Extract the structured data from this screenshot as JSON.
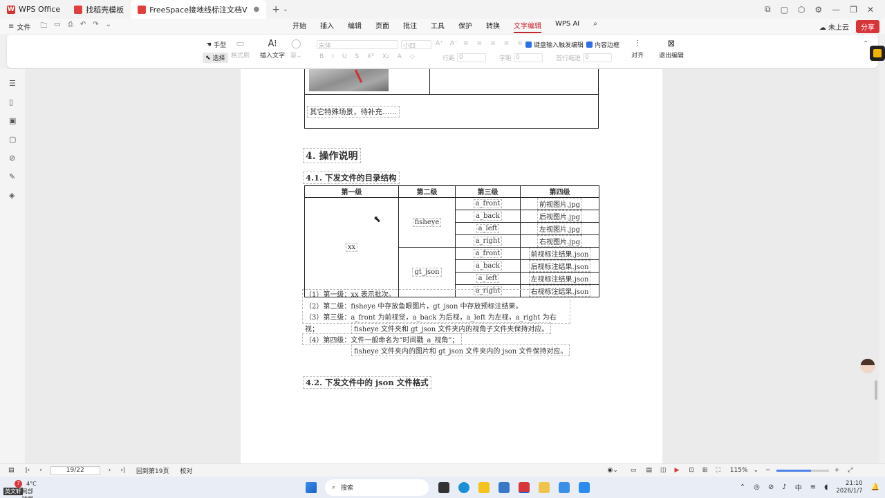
{
  "titlebar": {
    "tabs": [
      {
        "label": "WPS Office"
      },
      {
        "label": "找稻壳模板"
      },
      {
        "label": "FreeSpace接地线标注文档V"
      }
    ]
  },
  "menubar": {
    "file": "文件",
    "tabs": [
      "开始",
      "插入",
      "编辑",
      "页面",
      "批注",
      "工具",
      "保护",
      "转换",
      "文字编辑",
      "WPS AI"
    ],
    "selected_tab": "文字编辑",
    "cloud": "未上云",
    "share": "分享"
  },
  "ribbon": {
    "hand": "手型",
    "select": "选择",
    "format_painter": "格式刷",
    "insert_text": "插入文字",
    "font": "宋体",
    "font_size": "小四",
    "line_spacing_label": "行距",
    "line_spacing_value": "0",
    "char_spacing_label": "字距",
    "char_spacing_value": "0",
    "indent_label": "首行缩进",
    "indent_value": "0",
    "keyboard_input": "键盘输入触发编辑",
    "content_border": "内容边框",
    "align": "对齐",
    "exit_edit": "退出编辑"
  },
  "document": {
    "prev_cell_text": "其它特殊场景，待补充……",
    "heading4": "4.  操作说明",
    "heading41": "4.1.  下发文件的目录结构",
    "table": {
      "headers": [
        "第一级",
        "第二级",
        "第三级",
        "第四级"
      ],
      "level1": "xx",
      "groups": [
        {
          "level2": "fisheye",
          "rows": [
            [
              "a_front",
              "前视图片.jpg"
            ],
            [
              "a_back",
              "后视图片.jpg"
            ],
            [
              "a_left",
              "左视图片.jpg"
            ],
            [
              "a_right",
              "右视图片.jpg"
            ]
          ]
        },
        {
          "level2": "gt_json",
          "rows": [
            [
              "a_front",
              "前视标注结果.json"
            ],
            [
              "a_back",
              "后视标注结果.json"
            ],
            [
              "a_left",
              "左视标注结果.json"
            ],
            [
              "a_right",
              "右视标注结果.json"
            ]
          ]
        }
      ]
    },
    "notes": [
      "（1）第一级：xx 表示批次。",
      "（2）第二级：fisheye 中存放鱼眼图片，gt_json 中存放预标注结果。",
      "（3）第三级：a_front 为前视觉，a_back 为后视，a_left 为左视，a_right 为右视；",
      "fisheye 文件夹和 gt_json 文件夹内的视角子文件夹保持对应。",
      "（4）第四级：文件一般命名为“时间戳_a_视角”；",
      "fisheye 文件夹内的图片和 gt_json 文件夹内的 json 文件保持对应。"
    ],
    "heading42": "4.2.  下发文件中的 json 文件格式"
  },
  "statusbar": {
    "page": "19/22",
    "back_page": "回到第19页",
    "proofread": "校对",
    "zoom": "115%"
  },
  "taskbar": {
    "weather_temp": "4°C",
    "weather_desc": "局部晴朗",
    "weather_badge": "7",
    "search": "搜索",
    "ime": "中",
    "time": "21:10",
    "date": "2026/1/7",
    "ime_label": "英文轩"
  },
  "colors": {
    "accent": "#c4262e",
    "blue": "#2f6fe6"
  }
}
